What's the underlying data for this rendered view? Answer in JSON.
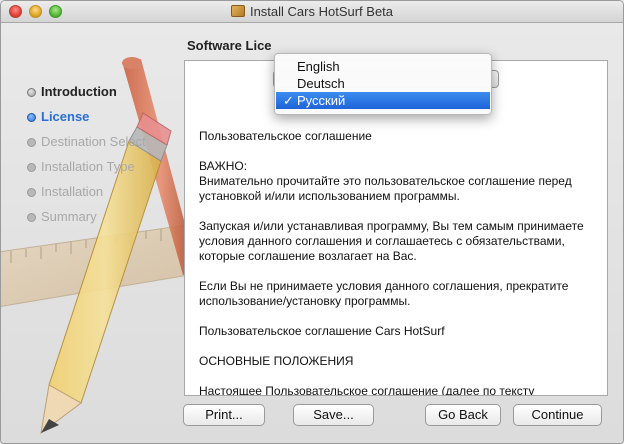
{
  "window": {
    "title": "Install Cars HotSurf Beta"
  },
  "subtitle": "Software Lice",
  "steps": [
    {
      "label": "Introduction",
      "state": "done"
    },
    {
      "label": "License",
      "state": "current"
    },
    {
      "label": "Destination Select",
      "state": "pending"
    },
    {
      "label": "Installation Type",
      "state": "pending"
    },
    {
      "label": "Installation",
      "state": "pending"
    },
    {
      "label": "Summary",
      "state": "pending"
    }
  ],
  "language_menu": {
    "options": [
      "English",
      "Deutsch",
      "Русский"
    ],
    "selected": "Русский",
    "check_mark": "✓"
  },
  "license": {
    "paragraphs": [
      "Пользовательское соглашение",
      "ВАЖНО:\nВнимательно прочитайте это пользовательское соглашение перед установкой и/или использованием программы.",
      "Запуская и/или устанавливая программу, Вы тем самым принимаете условия данного соглашения и соглашаетесь с обязательствами, которые соглашение возлагает на Вас.",
      "Если Вы не принимаете условия данного соглашения, прекратите использование/установку программы.",
      "Пользовательское соглашение Cars HotSurf",
      "ОСНОВНЫЕ ПОЛОЖЕНИЯ",
      "Настоящее Пользовательское соглашение (далее по тексту «Соглашение») заключается между Вами (далее по тексту «Пользователь»), конечным пользователем, и коммандой разработчиков Cars HotSurf Beta (далее по тексту Компания)"
    ]
  },
  "buttons": {
    "print": "Print...",
    "save": "Save...",
    "back": "Go Back",
    "continue": "Continue"
  }
}
